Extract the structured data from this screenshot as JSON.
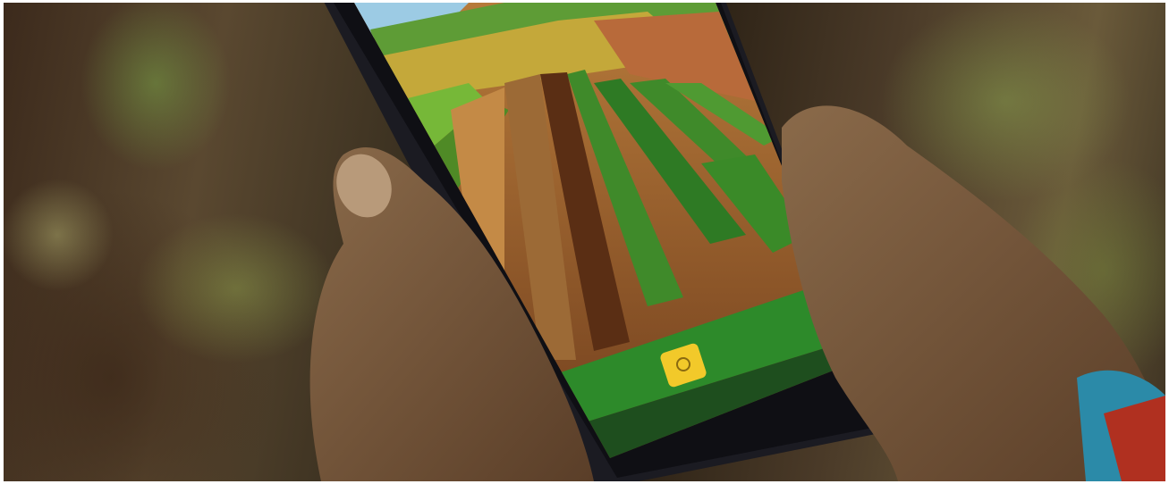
{
  "phone_screen": {
    "banner_text": "",
    "lower_text": "",
    "bottom_text": "",
    "app_icon": "sync-icon",
    "colors": {
      "banner": "#2d8a2a",
      "bar": "#1e4e1e",
      "app_icon": "#f2c92a"
    }
  }
}
